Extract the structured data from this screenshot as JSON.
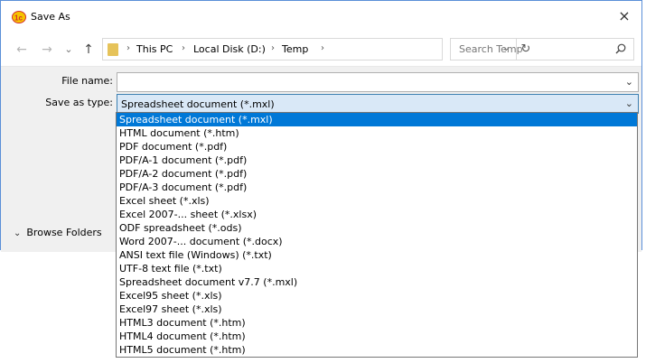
{
  "window": {
    "title": "Save As",
    "close_icon": "×"
  },
  "nav": {
    "back": "←",
    "forward": "→",
    "dropdown": "⌄",
    "up": "↑",
    "breadcrumbs": [
      "This PC",
      "Local Disk (D:)",
      "Temp"
    ],
    "separator": "›",
    "refresh": "↻",
    "search_placeholder": "Search Temp"
  },
  "form": {
    "file_name_label": "File name:",
    "file_name_value": "",
    "save_as_type_label": "Save as type:",
    "save_as_type_value": "Spreadsheet document (*.mxl)"
  },
  "browse_folders": "Browse Folders",
  "type_options": [
    "Spreadsheet document (*.mxl)",
    "HTML document (*.htm)",
    "PDF document (*.pdf)",
    "PDF/A-1 document (*.pdf)",
    "PDF/A-2 document (*.pdf)",
    "PDF/A-3 document (*.pdf)",
    "Excel sheet (*.xls)",
    "Excel 2007-... sheet (*.xlsx)",
    "ODF spreadsheet (*.ods)",
    "Word 2007-... document (*.docx)",
    "ANSI text file (Windows) (*.txt)",
    "UTF-8 text file (*.txt)",
    "Spreadsheet document v7.7 (*.mxl)",
    "Excel95 sheet (*.xls)",
    "Excel97 sheet (*.xls)",
    "HTML3 document (*.htm)",
    "HTML4 document (*.htm)",
    "HTML5 document (*.htm)"
  ],
  "selected_option_index": 0
}
